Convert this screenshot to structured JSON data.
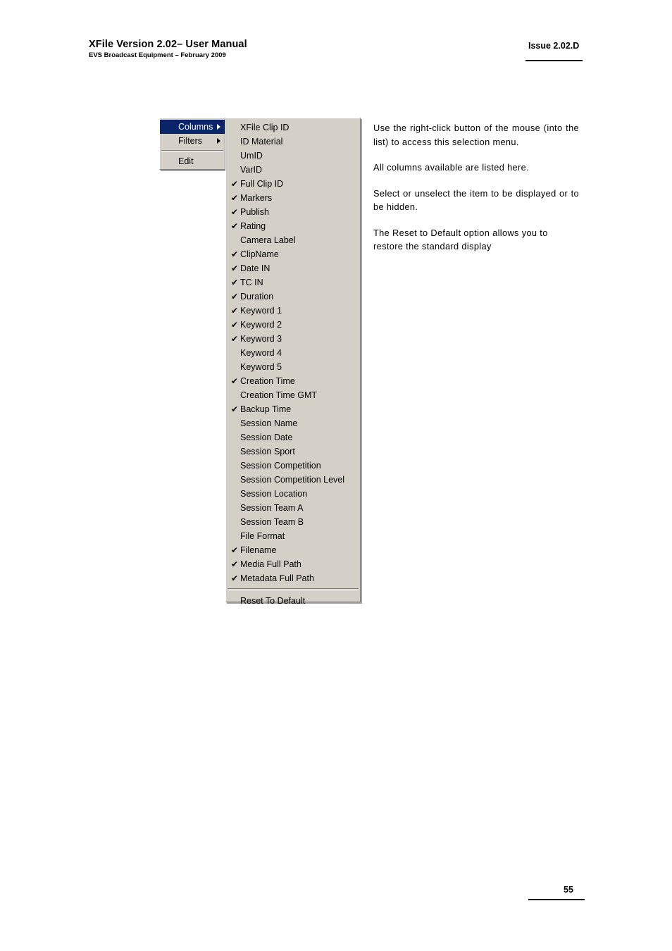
{
  "header": {
    "title": "XFile Version 2.02– User Manual",
    "subtitle": "EVS Broadcast Equipment – February 2009",
    "issue": "Issue 2.02.D"
  },
  "footer": {
    "page_number": "55"
  },
  "context_menu": {
    "items": [
      {
        "label": "Columns",
        "has_submenu": true,
        "selected": true
      },
      {
        "label": "Filters",
        "has_submenu": true,
        "selected": false
      },
      {
        "separator": true
      },
      {
        "label": "Edit",
        "has_submenu": false,
        "selected": false
      }
    ]
  },
  "columns_submenu": {
    "items": [
      {
        "label": "XFile Clip ID",
        "checked": false
      },
      {
        "label": "ID Material",
        "checked": false
      },
      {
        "label": "UmID",
        "checked": false
      },
      {
        "label": "VarID",
        "checked": false
      },
      {
        "label": "Full Clip ID",
        "checked": true
      },
      {
        "label": "Markers",
        "checked": true
      },
      {
        "label": "Publish",
        "checked": true
      },
      {
        "label": "Rating",
        "checked": true
      },
      {
        "label": "Camera Label",
        "checked": false
      },
      {
        "label": "ClipName",
        "checked": true
      },
      {
        "label": "Date IN",
        "checked": true
      },
      {
        "label": "TC IN",
        "checked": true
      },
      {
        "label": "Duration",
        "checked": true
      },
      {
        "label": "Keyword 1",
        "checked": true
      },
      {
        "label": "Keyword 2",
        "checked": true
      },
      {
        "label": "Keyword 3",
        "checked": true
      },
      {
        "label": "Keyword 4",
        "checked": false
      },
      {
        "label": "Keyword 5",
        "checked": false
      },
      {
        "label": "Creation Time",
        "checked": true
      },
      {
        "label": "Creation Time GMT",
        "checked": false
      },
      {
        "label": "Backup Time",
        "checked": true
      },
      {
        "label": "Session Name",
        "checked": false
      },
      {
        "label": "Session Date",
        "checked": false
      },
      {
        "label": "Session Sport",
        "checked": false
      },
      {
        "label": "Session Competition",
        "checked": false
      },
      {
        "label": "Session Competition Level",
        "checked": false
      },
      {
        "label": "Session Location",
        "checked": false
      },
      {
        "label": "Session Team A",
        "checked": false
      },
      {
        "label": "Session Team B",
        "checked": false
      },
      {
        "label": "File Format",
        "checked": false
      },
      {
        "label": "Filename",
        "checked": true
      },
      {
        "label": "Media Full Path",
        "checked": true
      },
      {
        "label": "Metadata Full Path",
        "checked": true
      }
    ],
    "reset_label": "Reset To Default",
    "check_glyph": "✔"
  },
  "notes": {
    "paragraphs": [
      "Use the right-click button of the mouse (into the list) to access this selection menu.",
      "All columns available are listed here.",
      "Select or unselect the item to be displayed or to be hidden.",
      "The Reset to Default option allows you to restore the standard display"
    ]
  },
  "colors": {
    "menu_background": "#d4d0c8",
    "menu_highlight": "#0a246a",
    "menu_highlight_text": "#ffffff",
    "text": "#000000"
  }
}
